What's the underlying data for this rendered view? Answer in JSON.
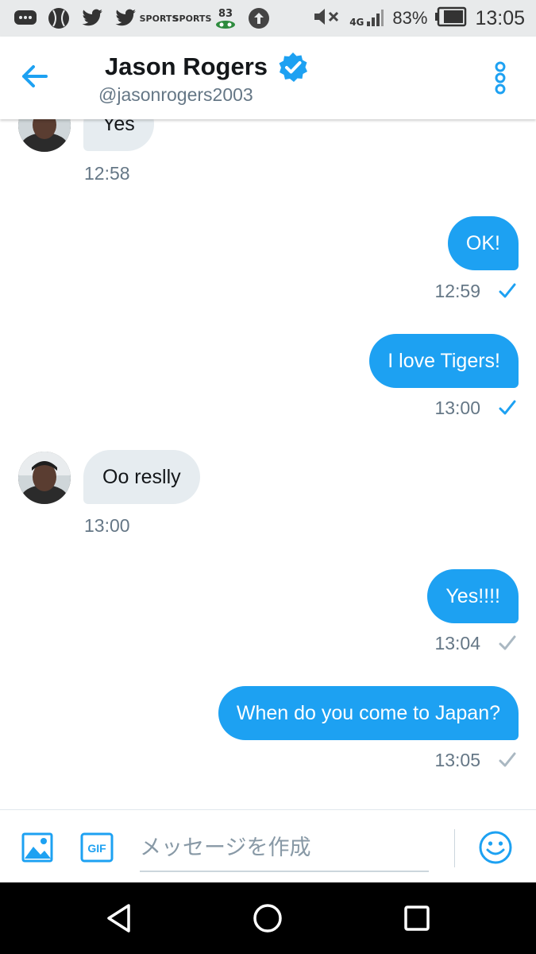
{
  "status_bar": {
    "icons": [
      "chat-icon",
      "baseball-icon",
      "twitter-icon",
      "twitter-icon",
      "sports-app-icon",
      "sports-app-icon",
      "battery-app-icon",
      "upload-icon",
      "mute-icon",
      "network-4g-icon"
    ],
    "app_label_1": "SPORTS",
    "app_label_2": "SPORTS",
    "app_badge": "83",
    "network": "4G",
    "battery_pct": "83%",
    "time": "13:05"
  },
  "header": {
    "name": "Jason Rogers",
    "handle": "@jasonrogers2003",
    "verified": true
  },
  "messages": [
    {
      "direction": "in",
      "text": "Yes",
      "time": "12:58"
    },
    {
      "direction": "out",
      "text": "OK!",
      "time": "12:59",
      "read": true
    },
    {
      "direction": "out",
      "text": "I love Tigers!",
      "time": "13:00",
      "read": true
    },
    {
      "direction": "in",
      "text": "Oo reslly",
      "time": "13:00"
    },
    {
      "direction": "out",
      "text": "Yes!!!!",
      "time": "13:04",
      "read": false
    },
    {
      "direction": "out",
      "text": "When do you come to Japan?",
      "time": "13:05",
      "read": false
    }
  ],
  "composer": {
    "placeholder": "メッセージを作成",
    "gif_label": "GIF"
  },
  "colors": {
    "accent": "#1da1f2",
    "incoming_bubble": "#e6ecf0",
    "timestamp": "#657786",
    "read_check": "#1da1f2",
    "sent_check": "#aab8c2"
  }
}
